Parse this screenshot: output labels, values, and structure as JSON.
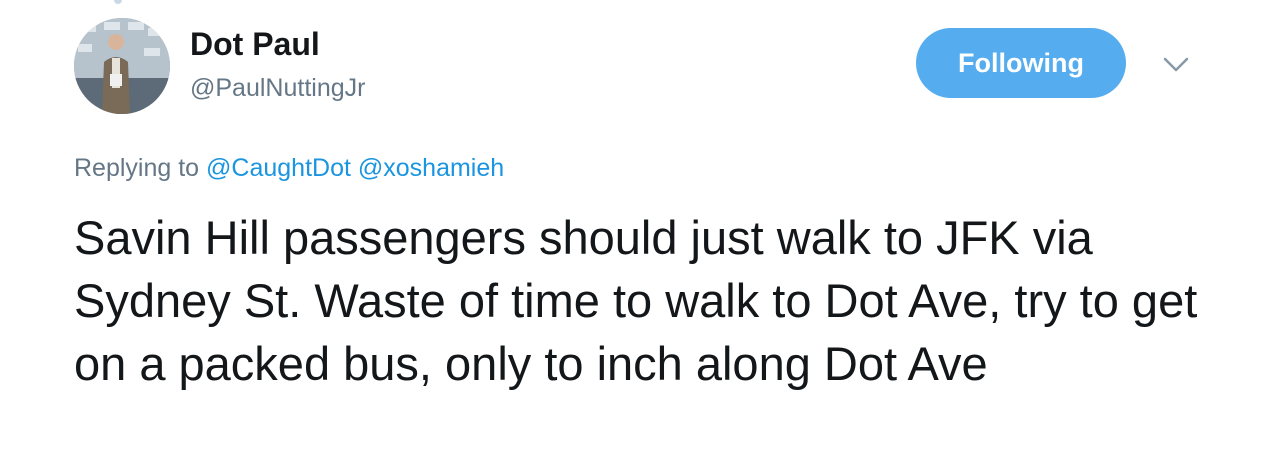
{
  "colors": {
    "accent": "#55acee",
    "link": "#1b95e0",
    "text_primary": "#14171a",
    "text_secondary": "#657786",
    "background": "#ffffff"
  },
  "author": {
    "display_name": "Dot Paul",
    "handle": "@PaulNuttingJr",
    "avatar_icon": "profile-photo"
  },
  "actions": {
    "follow_label": "Following",
    "menu_icon": "chevron-down-icon"
  },
  "reply": {
    "prefix": "Replying to",
    "mentions": [
      "@CaughtDot",
      "@xoshamieh"
    ]
  },
  "tweet": {
    "text": "Savin Hill passengers should just walk to JFK via Sydney St. Waste of time to walk to Dot Ave, try to get on a packed bus, only to inch along Dot Ave"
  }
}
